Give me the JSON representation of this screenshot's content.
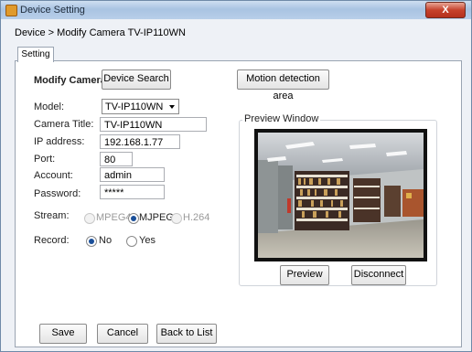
{
  "window": {
    "title": "Device Setting",
    "close_label": "X"
  },
  "breadcrumb": "Device > Modify Camera TV-IP110WN",
  "tab": {
    "label": "Setting"
  },
  "header": {
    "heading": "Modify Camera",
    "device_search": "Device Search",
    "motion_area": "Motion detection area"
  },
  "form": {
    "model_label": "Model:",
    "model_value": "TV-IP110WN",
    "camera_title_label": "Camera Title:",
    "camera_title_value": "TV-IP110WN",
    "ip_label": "IP address:",
    "ip_value": "192.168.1.77",
    "port_label": "Port:",
    "port_value": "80",
    "account_label": "Account:",
    "account_value": "admin",
    "password_label": "Password:",
    "password_value": "*****",
    "stream_label": "Stream:",
    "stream_options": [
      "MPEG4",
      "MJPEG",
      "H.264"
    ],
    "stream_selected": "MJPEG",
    "record_label": "Record:",
    "record_options": [
      "No",
      "Yes"
    ],
    "record_selected": "No"
  },
  "preview": {
    "title": "Preview Window",
    "preview_button": "Preview",
    "disconnect_button": "Disconnect"
  },
  "footer": {
    "save": "Save",
    "cancel": "Cancel",
    "back": "Back to List"
  },
  "colors": {
    "titlebar": "#b8cfe9",
    "close": "#c6422c",
    "radio_on": "#1a4f99"
  },
  "icons": [
    "app-icon",
    "close-icon",
    "dropdown-caret-icon"
  ]
}
